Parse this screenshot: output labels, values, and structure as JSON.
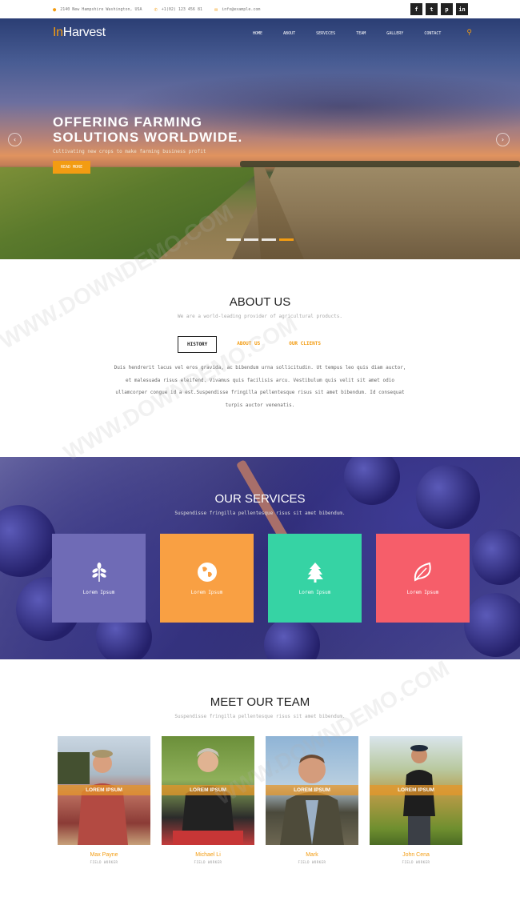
{
  "topbar": {
    "address": "2140 New Hampshire Washington, USA",
    "phone": "+1(02) 123 456 81",
    "email": "info@example.com",
    "socials": [
      "f",
      "t",
      "p",
      "in"
    ]
  },
  "header": {
    "logo_accent": "In",
    "logo_rest": "Harvest",
    "nav": [
      "HOME",
      "ABOUT",
      "SERVICES",
      "TEAM",
      "GALLERY",
      "CONTACT"
    ]
  },
  "hero": {
    "title": "OFFERING FARMING SOLUTIONS WORLDWIDE.",
    "subtitle": "Cultivating new crops to make farming business profit",
    "button": "READ MORE",
    "slides_total": 4,
    "active_slide": 4
  },
  "about": {
    "title": "ABOUT US",
    "subtitle": "We are a world-leading provider of agricultural products.",
    "tabs": [
      "HISTORY",
      "ABOUT US",
      "OUR CLIENTS"
    ],
    "active_tab": "HISTORY",
    "text": "Duis hendrerit lacus vel eros gravida, ac bibendum urna sollicitudin. Ut tempus leo quis diam auctor, et malesuada risus eleifend. Vivamus quis facilisis arcu. Vestibulum quis velit sit amet odio ullamcorper congue id a est.Suspendisse fringilla pellentesque risus sit amet bibendum. Id consequat turpis auctor venenatis."
  },
  "services": {
    "title": "OUR SERVICES",
    "subtitle": "Suspendisse fringilla pellentesque risus sit amet bibendum.",
    "cards": [
      {
        "label": "Lorem Ipsum",
        "icon": "leaf-branch-icon",
        "color": "#6f6bb6"
      },
      {
        "label": "Lorem Ipsum",
        "icon": "globe-icon",
        "color": "#f9a043"
      },
      {
        "label": "Lorem Ipsum",
        "icon": "pine-tree-icon",
        "color": "#36d3a4"
      },
      {
        "label": "Lorem Ipsum",
        "icon": "leaf-icon",
        "color": "#f65e6a"
      }
    ]
  },
  "team": {
    "title": "MEET OUR TEAM",
    "subtitle": "Suspendisse fringilla pellentesque risus sit amet bibendum.",
    "members": [
      {
        "name": "Max Payne",
        "role": "FIELD WORKER",
        "overlay": "LOREM IPSUM"
      },
      {
        "name": "Michael Li",
        "role": "FIELD WORKER",
        "overlay": "LOREM IPSUM"
      },
      {
        "name": "Mark",
        "role": "FIELD WORKER",
        "overlay": "LOREM IPSUM"
      },
      {
        "name": "John Cena",
        "role": "FIELD WORKER",
        "overlay": "LOREM IPSUM"
      }
    ]
  },
  "watermark": "WWW.DOWNDEMO.COM",
  "colors": {
    "accent": "#f39c12"
  }
}
